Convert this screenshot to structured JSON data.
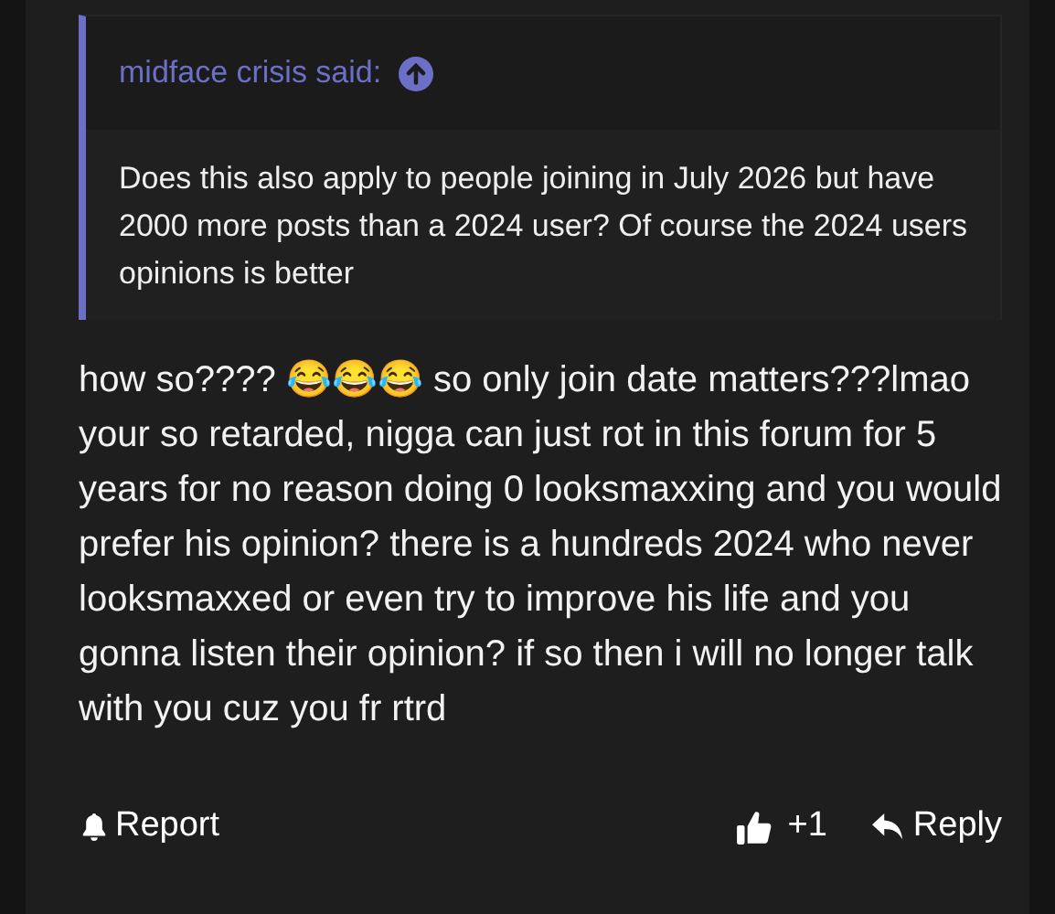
{
  "quote": {
    "author": "midface crisis said:",
    "text": "Does this also apply to people joining in July 2026 but have 2000 more posts than a 2024 user? Of course the 2024 users opinions is better"
  },
  "post": {
    "text": "how so???? 😂😂😂 so only join date matters???lmao your so retarded, nigga can just rot in this forum for 5 years for no reason doing 0 looksmaxxing and you would prefer his opinion? there is a hundreds 2024 who never looksmaxxed or even try to improve his life and you gonna listen their opinion? if so then i will no longer talk with you cuz you fr rtrd"
  },
  "footer": {
    "report": "Report",
    "like_count": "+1",
    "reply": "Reply"
  }
}
